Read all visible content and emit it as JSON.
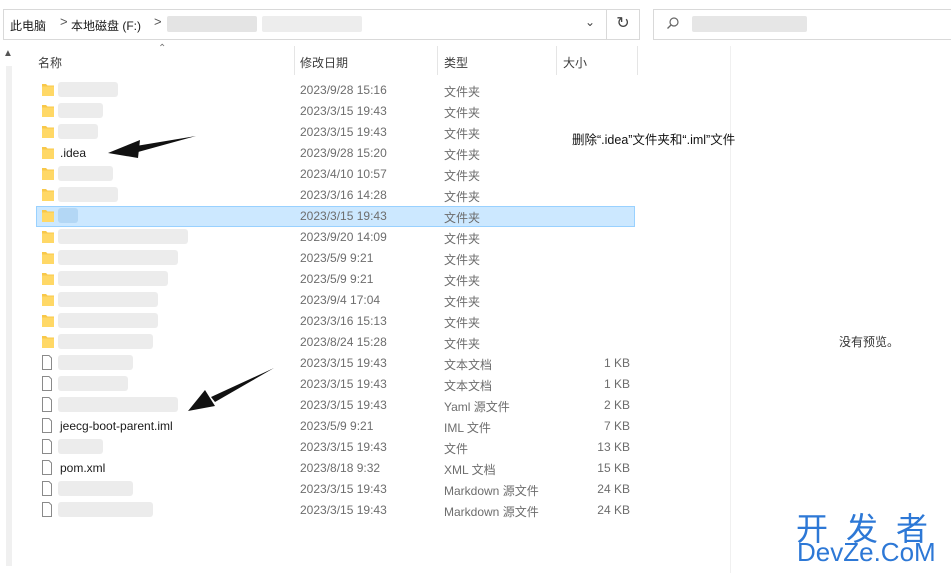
{
  "address_bar": {
    "crumbs": [
      "此电脑",
      "本地磁盘 (F:)"
    ],
    "separator": ">",
    "dropdown": "⌄",
    "refresh": "↻"
  },
  "columns": {
    "name": "名称",
    "date": "修改日期",
    "type": "类型",
    "size": "大小"
  },
  "rows": [
    {
      "name": "",
      "date": "2023/9/28 15:16",
      "type": "文件夹",
      "size": "",
      "icon": "folder-icon"
    },
    {
      "name": "",
      "date": "2023/3/15 19:43",
      "type": "文件夹",
      "size": "",
      "icon": "folder-icon"
    },
    {
      "name": "",
      "date": "2023/3/15 19:43",
      "type": "文件夹",
      "size": "",
      "icon": "folder-icon"
    },
    {
      "name": ".idea",
      "date": "2023/9/28 15:20",
      "type": "文件夹",
      "size": "",
      "icon": "folder-icon"
    },
    {
      "name": "",
      "date": "2023/4/10 10:57",
      "type": "文件夹",
      "size": "",
      "icon": "folder-icon"
    },
    {
      "name": "",
      "date": "2023/3/16 14:28",
      "type": "文件夹",
      "size": "",
      "icon": "folder-icon"
    },
    {
      "name": "",
      "date": "2023/3/15 19:43",
      "type": "文件夹",
      "size": "",
      "icon": "folder-icon",
      "selected": true
    },
    {
      "name": "",
      "date": "2023/9/20 14:09",
      "type": "文件夹",
      "size": "",
      "icon": "folder-icon"
    },
    {
      "name": "",
      "date": "2023/5/9 9:21",
      "type": "文件夹",
      "size": "",
      "icon": "folder-icon"
    },
    {
      "name": "",
      "date": "2023/5/9 9:21",
      "type": "文件夹",
      "size": "",
      "icon": "folder-icon"
    },
    {
      "name": "",
      "date": "2023/9/4 17:04",
      "type": "文件夹",
      "size": "",
      "icon": "folder-icon"
    },
    {
      "name": "",
      "date": "2023/3/16 15:13",
      "type": "文件夹",
      "size": "",
      "icon": "folder-icon"
    },
    {
      "name": "",
      "date": "2023/8/24 15:28",
      "type": "文件夹",
      "size": "",
      "icon": "folder-icon"
    },
    {
      "name": "",
      "date": "2023/3/15 19:43",
      "type": "文本文档",
      "size": "1 KB",
      "icon": "file-icon"
    },
    {
      "name": "",
      "date": "2023/3/15 19:43",
      "type": "文本文档",
      "size": "1 KB",
      "icon": "file-icon"
    },
    {
      "name": "",
      "date": "2023/3/15 19:43",
      "type": "Yaml 源文件",
      "size": "2 KB",
      "icon": "file-icon"
    },
    {
      "name": "jeecg-boot-parent.iml",
      "date": "2023/5/9 9:21",
      "type": "IML 文件",
      "size": "7 KB",
      "icon": "file-icon"
    },
    {
      "name": "",
      "date": "2023/3/15 19:43",
      "type": "文件",
      "size": "13 KB",
      "icon": "file-icon"
    },
    {
      "name": "pom.xml",
      "date": "2023/8/18 9:32",
      "type": "XML 文档",
      "size": "15 KB",
      "icon": "file-icon"
    },
    {
      "name": "",
      "date": "2023/3/15 19:43",
      "type": "Markdown 源文件",
      "size": "24 KB",
      "icon": "file-icon"
    },
    {
      "name": "",
      "date": "2023/3/15 19:43",
      "type": "Markdown 源文件",
      "size": "24 KB",
      "icon": "file-icon"
    }
  ],
  "annotation": "删除“.idea”文件夹和“.iml”文件",
  "preview_text": "没有预览。",
  "watermark": {
    "line1": "开发者",
    "line2": "DevZe.CoM"
  },
  "colors": {
    "folder": "#f8c84a",
    "selection": "#cce8ff",
    "watermark": "#2d78d6"
  }
}
